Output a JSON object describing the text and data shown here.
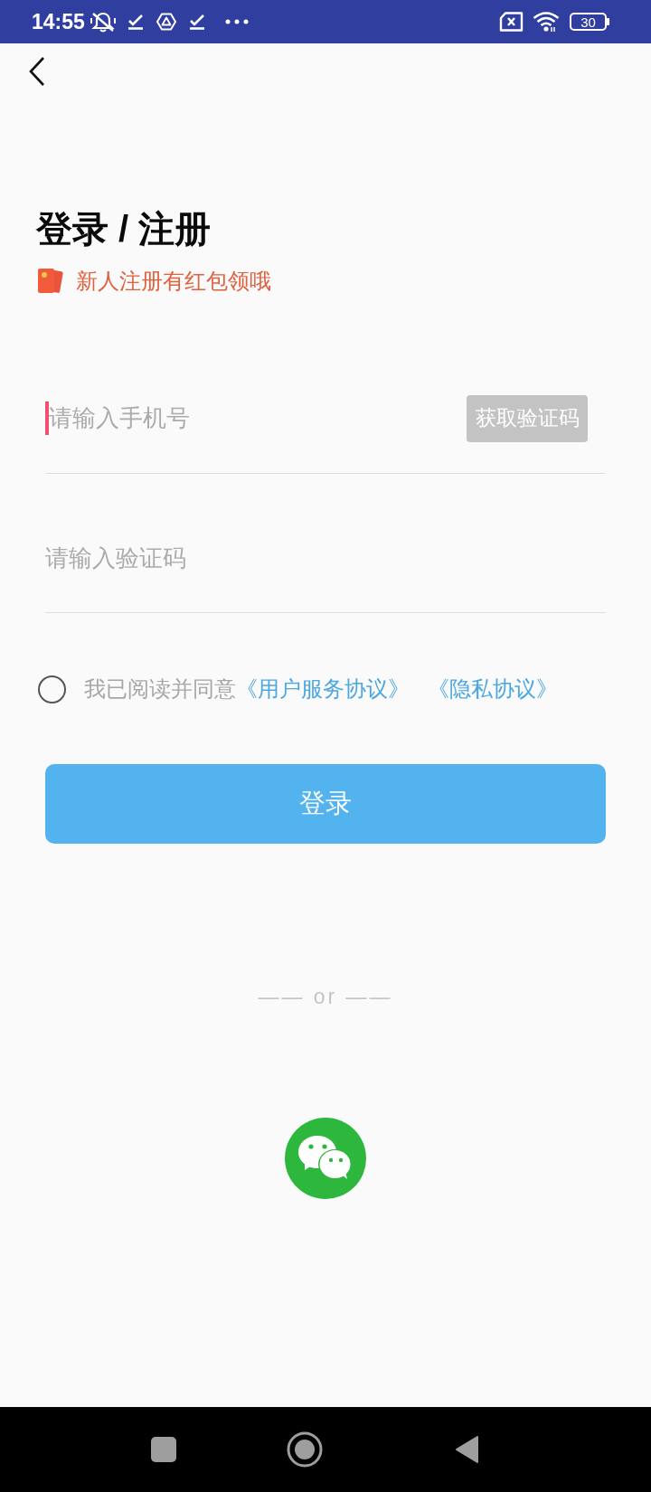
{
  "status_bar": {
    "time": "14:55",
    "battery": "30"
  },
  "title": "登录 / 注册",
  "promo": "新人注册有红包领哦",
  "phone_field": {
    "placeholder": "请输入手机号",
    "focused": true
  },
  "code_button": {
    "label": "获取验证码",
    "disabled": true
  },
  "code_field": {
    "placeholder": "请输入验证码"
  },
  "agreement": {
    "checked": false,
    "text": "我已阅读并同意",
    "links": [
      "《用户服务协议》",
      "《隐私协议》"
    ]
  },
  "login_button": {
    "label": "登录"
  },
  "separator": {
    "label": "—— or ——"
  },
  "nav_bar": {
    "buttons": [
      {
        "kind": "recents"
      },
      {
        "kind": "home"
      },
      {
        "kind": "back"
      }
    ]
  }
}
